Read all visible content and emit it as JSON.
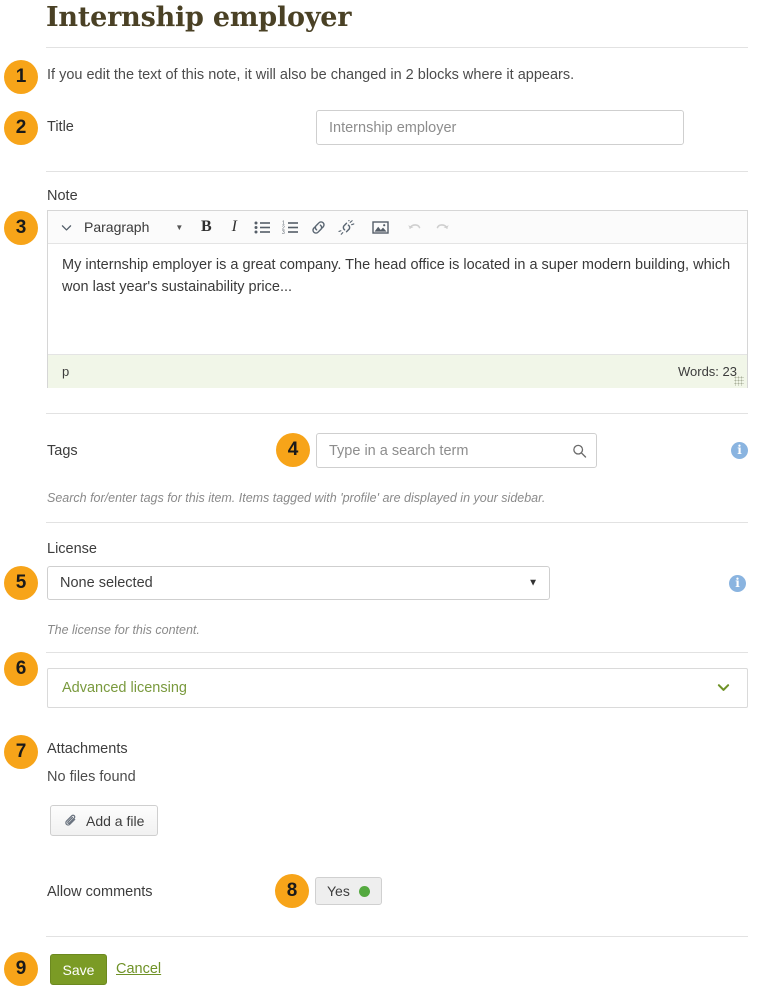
{
  "page": {
    "title": "Internship employer",
    "intro_note": "If you edit the text of this note, it will also be changed in 2 blocks where it appears."
  },
  "callouts": [
    {
      "number": "1"
    },
    {
      "number": "2"
    },
    {
      "number": "3"
    },
    {
      "number": "4"
    },
    {
      "number": "5"
    },
    {
      "number": "6"
    },
    {
      "number": "7"
    },
    {
      "number": "8"
    },
    {
      "number": "9"
    }
  ],
  "title_field": {
    "label": "Title",
    "value": "Internship employer",
    "placeholder": "Internship employer"
  },
  "note_field": {
    "label": "Note",
    "body": "My internship employer is a great company. The head office is located in a super modern building, which won last year's sustainability price...",
    "toolbar": {
      "collapse_icon": "chevron-down-icon",
      "format_label": "Paragraph",
      "bold_label": "B",
      "italic_label": "I",
      "bullet_list_icon": "unordered-list-icon",
      "numbered_list_icon": "ordered-list-icon",
      "link_icon": "link-icon",
      "unlink_icon": "unlink-icon",
      "image_icon": "image-icon",
      "undo_icon": "undo-icon",
      "redo_icon": "redo-icon"
    },
    "status": {
      "element_path": "p",
      "word_count": "Words: 23"
    }
  },
  "tags_field": {
    "label": "Tags",
    "placeholder": "Type in a search term",
    "value": "",
    "search_icon": "search-icon",
    "help": "Search for/enter tags for this item. Items tagged with 'profile' are displayed in your sidebar.",
    "info_icon": "info-icon"
  },
  "license_field": {
    "label": "License",
    "selected": "None selected",
    "help": "The license for this content.",
    "info_icon": "info-icon"
  },
  "advanced_licensing": {
    "label": "Advanced licensing",
    "caret_icon": "chevron-down-icon"
  },
  "attachments": {
    "label": "Attachments",
    "empty_text": "No files found",
    "add_button": "Add a file",
    "paperclip_icon": "paperclip-icon"
  },
  "allow_comments": {
    "label": "Allow comments",
    "value": "Yes"
  },
  "actions": {
    "save": "Save",
    "cancel": "Cancel"
  },
  "colors": {
    "badge": "#F7A419",
    "title": "#4a4125",
    "primary_button": "#7b9b25",
    "link_green": "#6f9227",
    "toggle_on": "#54a93f",
    "info_blue": "#8ab4e0",
    "status_bar": "#f1f6e8"
  }
}
